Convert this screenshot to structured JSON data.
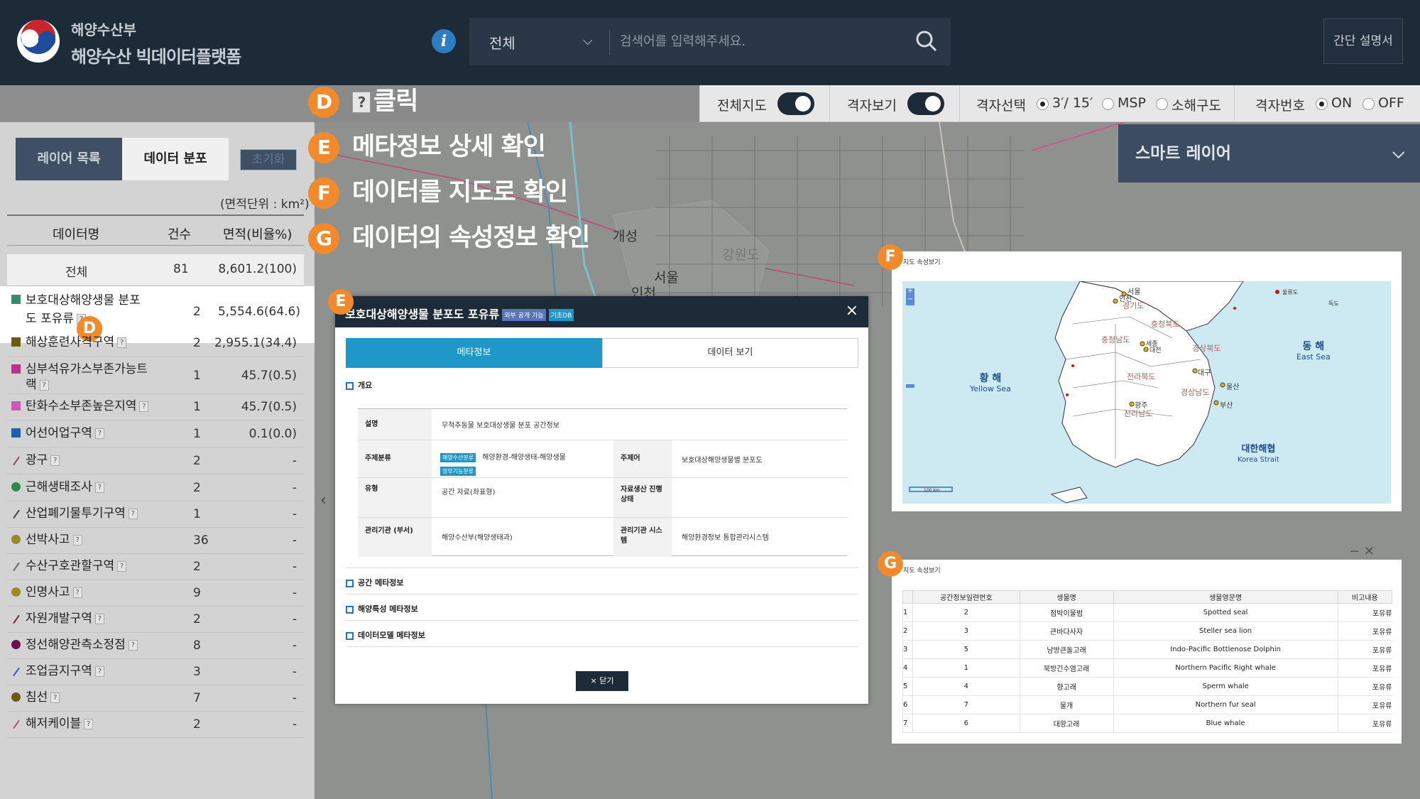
{
  "header": {
    "org": "해양수산부",
    "platform": "해양수산 빅데이터플랫폼",
    "info_icon": "i",
    "search_category": "전체",
    "search_placeholder": "검색어를 입력해주세요.",
    "guide_button": "간단 설명서"
  },
  "toolbar": {
    "full_map": "전체지도",
    "grid_view": "격자보기",
    "grid_select": "격자선택",
    "grid_opt1": "3′/ 15′",
    "grid_opt2": "MSP",
    "grid_opt3": "소해구도",
    "grid_number": "격자번호",
    "on": "ON",
    "off": "OFF"
  },
  "left_panel": {
    "tab_layers": "레이어 목록",
    "tab_distribution": "데이터 분포",
    "reset": "초기화",
    "unit": "(면적단위 : km²)",
    "col_name": "데이터명",
    "col_count": "건수",
    "col_area": "면적(비율%)",
    "total": {
      "name": "전체",
      "count": "81",
      "area": "8,601.2(100)"
    },
    "selected": {
      "name": "보호대상해양생물 분포도 포유류",
      "count": "2",
      "area": "5,554.6(64.6)",
      "color": "#3a8a6c"
    },
    "rows": [
      {
        "name": "해상훈련사격구역",
        "count": "2",
        "area": "2,955.1(34.4)",
        "color": "#6b5a12",
        "shape": "sq"
      },
      {
        "name": "심부석유가스부존가능트랙",
        "count": "1",
        "area": "45.7(0.5)",
        "color": "#b8338e",
        "shape": "sq"
      },
      {
        "name": "탄화수소부존높은지역",
        "count": "1",
        "area": "45.7(0.5)",
        "color": "#c95ab7",
        "shape": "sq"
      },
      {
        "name": "어선어업구역",
        "count": "1",
        "area": "0.1(0.0)",
        "color": "#1f5fa8",
        "shape": "sq"
      },
      {
        "name": "광구",
        "count": "2",
        "area": "-",
        "color": "#b03a5a",
        "shape": "line"
      },
      {
        "name": "근해생태조사",
        "count": "2",
        "area": "-",
        "color": "#2f8a4a",
        "shape": "dot"
      },
      {
        "name": "산업폐기물투기구역",
        "count": "1",
        "area": "-",
        "color": "#444",
        "shape": "line"
      },
      {
        "name": "선박사고",
        "count": "36",
        "area": "-",
        "color": "#9a8a2a",
        "shape": "dot"
      },
      {
        "name": "수산구호관할구역",
        "count": "2",
        "area": "-",
        "color": "#666",
        "shape": "line"
      },
      {
        "name": "인명사고",
        "count": "9",
        "area": "-",
        "color": "#a08a22",
        "shape": "dot"
      },
      {
        "name": "자원개발구역",
        "count": "2",
        "area": "-",
        "color": "#7a2a2a",
        "shape": "line"
      },
      {
        "name": "정선해양관측소정점",
        "count": "8",
        "area": "-",
        "color": "#6a1050",
        "shape": "dot"
      },
      {
        "name": "조업금지구역",
        "count": "3",
        "area": "-",
        "color": "#3a5ab0",
        "shape": "line"
      },
      {
        "name": "침선",
        "count": "7",
        "area": "-",
        "color": "#6a5a12",
        "shape": "dot"
      },
      {
        "name": "해저케이블",
        "count": "2",
        "area": "-",
        "color": "#c04a6a",
        "shape": "line"
      }
    ]
  },
  "smart_layer": "스마트 레이어",
  "steps": [
    {
      "badge": "D",
      "text": "클릭"
    },
    {
      "badge": "E",
      "text": "메타정보 상세 확인"
    },
    {
      "badge": "F",
      "text": "데이터를 지도로 확인"
    },
    {
      "badge": "G",
      "text": "데이터의 속성정보 확인"
    }
  ],
  "popup": {
    "title": "보호대상해양생물 분포도 포유류",
    "tag1": "외부 공개 가능",
    "tag2": "기초DB",
    "tab_meta": "메타정보",
    "tab_data": "데이터 보기",
    "sec_overview": "개요",
    "desc_label": "설명",
    "desc_value": "무척추동물 보호대상생물 분포 공간정보",
    "topic_label": "주제분류",
    "topic_tag1": "해양수산분류",
    "topic_tag2": "정부기능분류",
    "topic_value": "해양환경-해양생태-해양생물",
    "keyword_label": "주제어",
    "keyword_value": "보호대상해양생물별 분포도",
    "type_label": "유형",
    "type_value": "공간 자료(좌표형)",
    "status_label": "자료생산 진행상태",
    "org_label": "관리기관 (부서)",
    "org_value": "해양수산부(해양생태과)",
    "system_label": "관리기관 시스템",
    "system_value": "해양환경정보 통합관리시스템",
    "sec_spatial": "공간 메타정보",
    "sec_ocean": "해양특성 메타정보",
    "sec_model": "데이터모델 메타정보",
    "close": "× 닫기"
  },
  "fpanel": {
    "title": "지도 속성보기",
    "scale": "100 km",
    "labels": {
      "yellow_sea_ko": "황 해",
      "yellow_sea_en": "Yellow Sea",
      "east_sea_ko": "동 해",
      "east_sea_en": "East Sea",
      "strait_ko": "대한해협",
      "strait_en": "Korea Strait",
      "seoul": "서울",
      "incheon": "인천",
      "gyeonggi": "경기도",
      "chungbuk": "충청북도",
      "chungnam": "충청남도",
      "sejong": "세종",
      "daejeon": "대전",
      "gyeongbuk": "경상북도",
      "daegu": "대구",
      "jeonbuk": "전라북도",
      "gyeongnam": "경상남도",
      "ulsan": "울산",
      "gwangju": "광주",
      "jeonnam": "전라남도",
      "busan": "부산",
      "ulleungdo": "울릉도",
      "dokdo": "독도"
    }
  },
  "gpanel": {
    "title": "지도 속성보기",
    "headers": [
      "",
      "공간정보일련번호",
      "생물명",
      "생물영문명",
      "비고내용"
    ],
    "rows": [
      [
        "1",
        "2",
        "점박이물범",
        "Spotted seal",
        "포유류"
      ],
      [
        "2",
        "3",
        "큰바다사자",
        "Steller sea lion",
        "포유류"
      ],
      [
        "3",
        "5",
        "남방큰돌고래",
        "Indo-Pacific Bottlenose Dolphin",
        "포유류"
      ],
      [
        "4",
        "1",
        "북방긴수염고래",
        "Northern Pacific Right whale",
        "포유류"
      ],
      [
        "5",
        "4",
        "향고래",
        "Sperm whale",
        "포유류"
      ],
      [
        "6",
        "7",
        "물개",
        "Northern fur seal",
        "포유류"
      ],
      [
        "7",
        "6",
        "대왕고래",
        "Blue whale",
        "포유류"
      ]
    ]
  },
  "map_labels": {
    "seoul": "서울",
    "incheon": "인천",
    "gaeseong": "개성",
    "gangwon": "강원도"
  },
  "colors": {
    "header_bg": "#1d2a38",
    "accent_blue": "#1f97c8",
    "badge_orange": "#f08a2c"
  }
}
